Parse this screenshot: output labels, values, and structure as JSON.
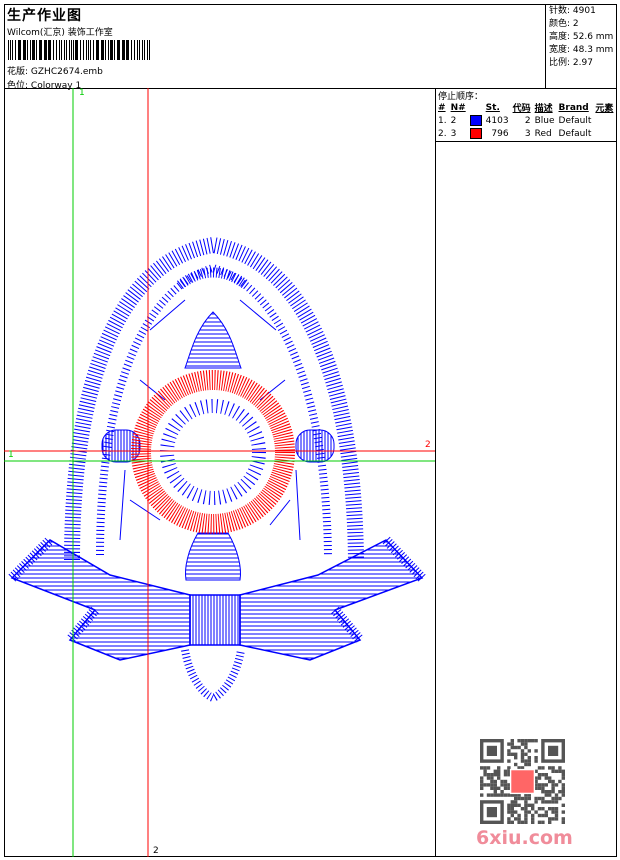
{
  "header": {
    "title": "生产作业图",
    "company": "Wilcom(汇京) 装饰工作室",
    "design_label": "花版:",
    "design_value": "GZHC2674.emb",
    "colorway_label": "色位:",
    "colorway_value": "Colorway 1"
  },
  "info": {
    "stitches": "针数: 4901",
    "colors": "颜色: 2",
    "height": "高度: 52.6 mm",
    "width": "宽度: 48.3 mm",
    "scale": "比例: 2.97"
  },
  "stop_sequence": {
    "title": "停止顺序：",
    "columns": [
      "#",
      "N#",
      "",
      "St.",
      "代码",
      "描述",
      "Brand",
      "元素"
    ],
    "rows": [
      {
        "idx": "1.",
        "n": "2",
        "color": "#0000ff",
        "st": "4103",
        "code": "2",
        "desc": "Blue",
        "brand": "Default",
        "element": ""
      },
      {
        "idx": "2.",
        "n": "3",
        "color": "#ff0000",
        "st": "796",
        "code": "3",
        "desc": "Red",
        "brand": "Default",
        "element": ""
      }
    ]
  },
  "guides": {
    "v1": "1",
    "v2": "2",
    "h1": "1",
    "h2": "2"
  },
  "watermark": "6xiu.com",
  "colors": {
    "blue": "#0000ff",
    "red": "#ff0000",
    "guide_green": "#00cc00",
    "guide_red": "#ff0000"
  }
}
